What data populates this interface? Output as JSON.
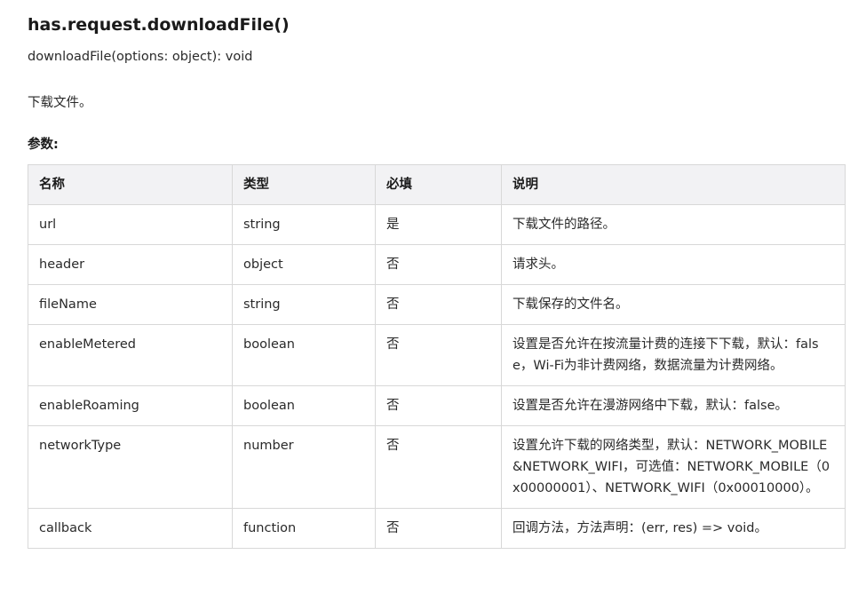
{
  "doc": {
    "title": "has.request.downloadFile()",
    "signature": "downloadFile(options: object): void",
    "description": "下载文件。",
    "params_label": "参数:"
  },
  "table": {
    "headers": [
      "名称",
      "类型",
      "必填",
      "说明"
    ],
    "rows": [
      {
        "name": "url",
        "type": "string",
        "required": "是",
        "desc": "下载文件的路径。"
      },
      {
        "name": "header",
        "type": "object",
        "required": "否",
        "desc": "请求头。"
      },
      {
        "name": "fileName",
        "type": "string",
        "required": "否",
        "desc": "下载保存的文件名。"
      },
      {
        "name": "enableMetered",
        "type": "boolean",
        "required": "否",
        "desc": "设置是否允许在按流量计费的连接下下载，默认：false，Wi-Fi为非计费网络，数据流量为计费网络。"
      },
      {
        "name": "enableRoaming",
        "type": "boolean",
        "required": "否",
        "desc": "设置是否允许在漫游网络中下载，默认：false。"
      },
      {
        "name": "networkType",
        "type": "number",
        "required": "否",
        "desc": "设置允许下载的网络类型，默认：NETWORK_MOBILE&NETWORK_WIFI，可选值：NETWORK_MOBILE（0x00000001）、NETWORK_WIFI（0x00010000）。"
      },
      {
        "name": "callback",
        "type": "function",
        "required": "否",
        "desc": "回调方法，方法声明：(err, res) => void。"
      }
    ]
  }
}
